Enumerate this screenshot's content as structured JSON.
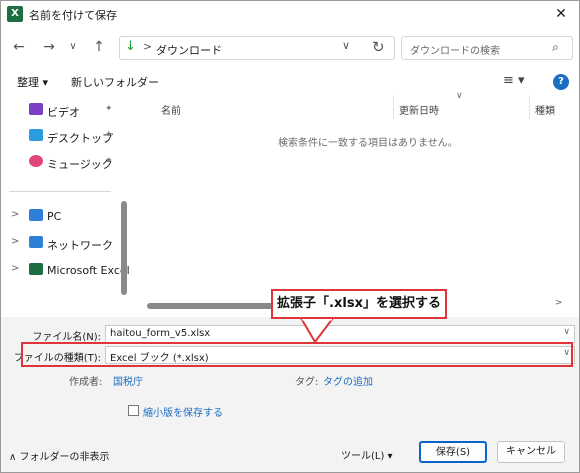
{
  "window": {
    "title": "名前を付けて保存",
    "app_badge": "X"
  },
  "nav": {
    "back_glyph": "←",
    "forward_glyph": "→",
    "recent_glyph": "∨",
    "up_glyph": "↑",
    "address_icon": "↓",
    "address_sep": ">",
    "address_path": "ダウンロード",
    "address_chevron": "∨",
    "refresh_glyph": "↻",
    "search_placeholder": "ダウンロードの検索",
    "search_glyph": "⌕"
  },
  "toolbar": {
    "organize": "整理 ▾",
    "new_folder": "新しいフォルダー",
    "view_glyph": "≡ ▾",
    "help": "?"
  },
  "sidebar": {
    "quick_items": [
      {
        "label": "ビデオ",
        "icon": "video-icon",
        "color": "#7b3fc4",
        "pinned": true
      },
      {
        "label": "デスクトップ",
        "icon": "desktop-icon",
        "color": "#2d9be0",
        "pinned": true
      },
      {
        "label": "ミュージック",
        "icon": "music-icon",
        "color": "#e0457b",
        "pinned": true
      }
    ],
    "tree_items": [
      {
        "label": "PC",
        "icon": "pc-icon",
        "color": "#2d7fd8"
      },
      {
        "label": "ネットワーク",
        "icon": "network-icon",
        "color": "#2d7fd8"
      },
      {
        "label": "Microsoft Excel",
        "icon": "excel-icon",
        "color": "#1d6f42"
      }
    ],
    "pin_glyph": "📌",
    "expand_glyph": ">"
  },
  "file_list": {
    "columns": [
      "名前",
      "更新日時",
      "種類"
    ],
    "sort_glyph": "∨",
    "empty_message": "検索条件に一致する項目はありません。",
    "scroll_arrow": ">"
  },
  "callout": {
    "text": "拡張子「.xlsx」を選択する",
    "color": "#e0343a"
  },
  "form": {
    "filename_label": "ファイル名(N):",
    "filename_value": "haitou_form_v5.xlsx",
    "filetype_label": "ファイルの種類(T):",
    "filetype_value": "Excel ブック (*.xlsx)",
    "author_label": "作成者:",
    "author_value": "国税庁",
    "tags_label": "タグ:",
    "tags_value": "タグの追加",
    "thumbnail_label": "縮小版を保存する",
    "field_chevron": "∨"
  },
  "footer": {
    "hide_folders": "フォルダーの非表示",
    "hide_glyph": "∧",
    "tools": "ツール(L)  ▾",
    "save": "保存(S)",
    "cancel": "キャンセル"
  },
  "colors": {
    "accent": "#1b6ec2",
    "highlight": "#e0343a",
    "primary_border": "#0a64c8"
  }
}
